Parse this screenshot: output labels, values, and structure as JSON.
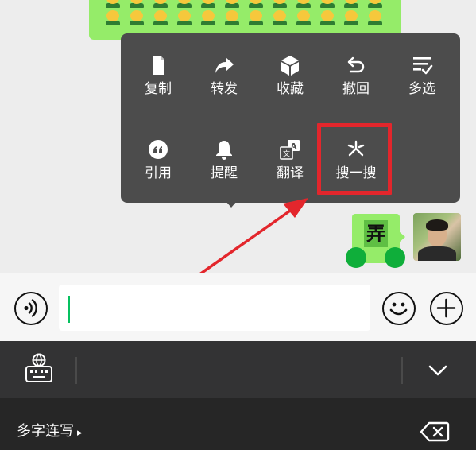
{
  "colors": {
    "chat_background": "#ededed",
    "bubble_green": "#95ec69",
    "menu_background": "#4c4c4c",
    "highlight_red": "#e3262c",
    "caret_green": "#07c160",
    "keyboard_toolbar": "#333334",
    "keyboard_background": "#262626"
  },
  "chat": {
    "emoji_sticker_icon": "yellow-emoji-face-icon",
    "message_sticker_text": "弄"
  },
  "context_menu": {
    "row1": [
      {
        "label": "复制",
        "icon": "document-icon"
      },
      {
        "label": "转发",
        "icon": "share-arrow-icon"
      },
      {
        "label": "收藏",
        "icon": "cube-icon"
      },
      {
        "label": "撤回",
        "icon": "undo-icon"
      },
      {
        "label": "多选",
        "icon": "checklist-icon"
      }
    ],
    "row2": [
      {
        "label": "引用",
        "icon": "quote-icon"
      },
      {
        "label": "提醒",
        "icon": "bell-icon"
      },
      {
        "label": "翻译",
        "icon": "translate-icon"
      },
      {
        "label": "搜一搜",
        "icon": "sparkle-icon"
      }
    ]
  },
  "input_bar": {
    "voice_icon": "voice-icon",
    "emoji_icon": "smiley-icon",
    "plus_icon": "plus-icon",
    "text_value": ""
  },
  "keyboard": {
    "switch_icon": "globe-keyboard-icon",
    "collapse_icon": "chevron-down-icon",
    "mode_label": "多字连写",
    "mode_arrow": "▸",
    "backspace_icon": "backspace-icon"
  }
}
